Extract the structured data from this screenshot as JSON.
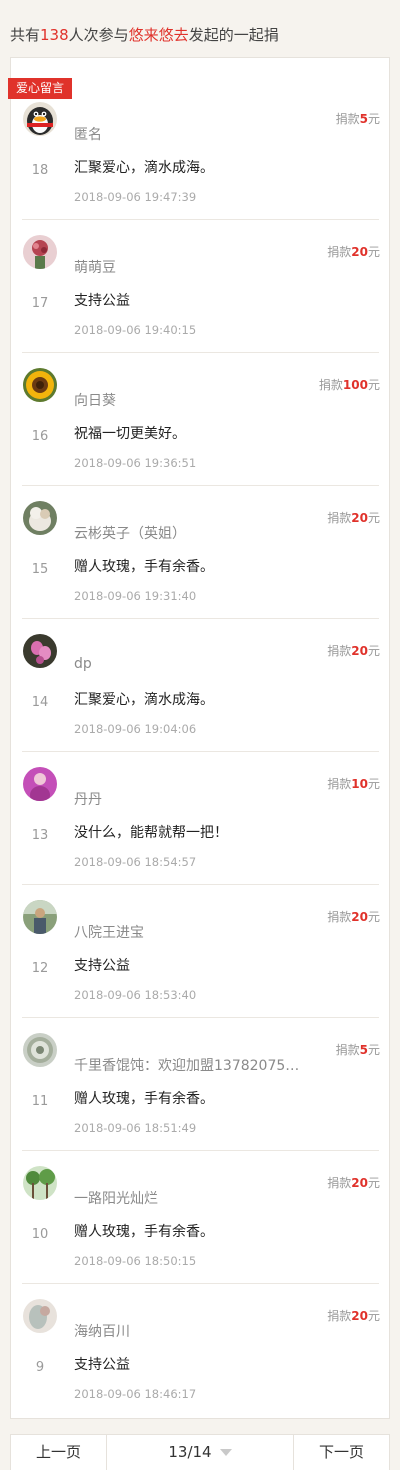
{
  "header": {
    "prefix": "共有",
    "count": "138",
    "middle": "人次参与",
    "organizer": "悠来悠去",
    "suffix": "发起的一起捐"
  },
  "badge": "爱心留言",
  "colors": {
    "accent": "#e0322b"
  },
  "amount_label": "捐款",
  "currency_unit": "元",
  "entries": [
    {
      "num": "18",
      "name": "匿名",
      "amount": "5",
      "message": "汇聚爱心，滴水成海。",
      "time": "2018-09-06 19:47:39"
    },
    {
      "num": "17",
      "name": "萌萌豆",
      "amount": "20",
      "message": "支持公益",
      "time": "2018-09-06 19:40:15"
    },
    {
      "num": "16",
      "name": "向日葵",
      "amount": "100",
      "message": "祝福一切更美好。",
      "time": "2018-09-06 19:36:51"
    },
    {
      "num": "15",
      "name": "云彬英子（英姐）",
      "amount": "20",
      "message": "赠人玫瑰，手有余香。",
      "time": "2018-09-06 19:31:40"
    },
    {
      "num": "14",
      "name": "dp",
      "amount": "20",
      "message": "汇聚爱心，滴水成海。",
      "time": "2018-09-06 19:04:06"
    },
    {
      "num": "13",
      "name": "丹丹",
      "amount": "10",
      "message": "没什么，能帮就帮一把！",
      "time": "2018-09-06 18:54:57"
    },
    {
      "num": "12",
      "name": "八院王进宝",
      "amount": "20",
      "message": "支持公益",
      "time": "2018-09-06 18:53:40"
    },
    {
      "num": "11",
      "name": "千里香馄饨：欢迎加盟13782075…",
      "amount": "5",
      "message": "赠人玫瑰，手有余香。",
      "time": "2018-09-06 18:51:49"
    },
    {
      "num": "10",
      "name": "一路阳光灿烂",
      "amount": "20",
      "message": "赠人玫瑰，手有余香。",
      "time": "2018-09-06 18:50:15"
    },
    {
      "num": "9",
      "name": "海纳百川",
      "amount": "20",
      "message": "支持公益",
      "time": "2018-09-06 18:46:17"
    }
  ],
  "pager": {
    "prev": "上一页",
    "current": "13/14",
    "next": "下一页"
  }
}
